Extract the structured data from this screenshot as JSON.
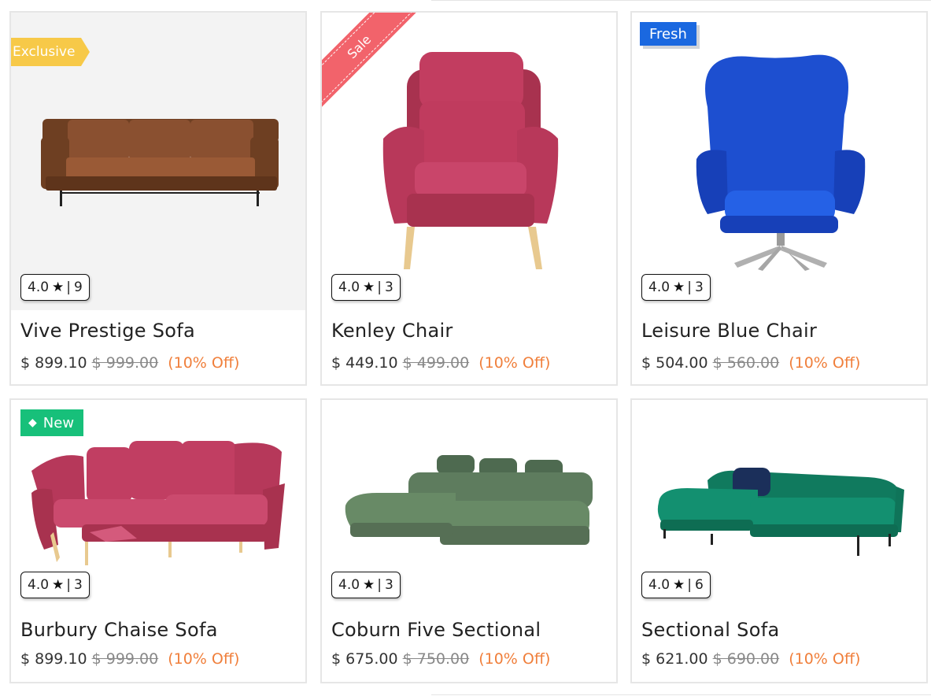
{
  "products": [
    {
      "name": "Vive Prestige Sofa",
      "price": "$ 899.10",
      "old_price": "$ 999.00",
      "discount": "(10% Off)",
      "rating": "4.0",
      "reviews": "9",
      "badge": "Exclusive"
    },
    {
      "name": "Kenley Chair",
      "price": "$ 449.10",
      "old_price": "$ 499.00",
      "discount": "(10% Off)",
      "rating": "4.0",
      "reviews": "3",
      "badge": "Sale"
    },
    {
      "name": "Leisure Blue Chair",
      "price": "$ 504.00",
      "old_price": "$ 560.00",
      "discount": "(10% Off)",
      "rating": "4.0",
      "reviews": "3",
      "badge": "Fresh"
    },
    {
      "name": "Burbury Chaise Sofa",
      "price": "$ 899.10",
      "old_price": "$ 999.00",
      "discount": "(10% Off)",
      "rating": "4.0",
      "reviews": "3",
      "badge": "New"
    },
    {
      "name": "Coburn Five Sectional",
      "price": "$ 675.00",
      "old_price": "$ 750.00",
      "discount": "(10% Off)",
      "rating": "4.0",
      "reviews": "3",
      "badge": ""
    },
    {
      "name": "Sectional Sofa",
      "price": "$ 621.00",
      "old_price": "$ 690.00",
      "discount": "(10% Off)",
      "rating": "4.0",
      "reviews": "6",
      "badge": ""
    }
  ],
  "rating_separator": "|",
  "icons": {
    "star": "star-icon",
    "tag": "tag-icon"
  },
  "colors": {
    "exclusive": "#f7c948",
    "sale": "#f2636b",
    "fresh": "#1a68e0",
    "new": "#17c07a",
    "discount": "#f07f3b"
  }
}
